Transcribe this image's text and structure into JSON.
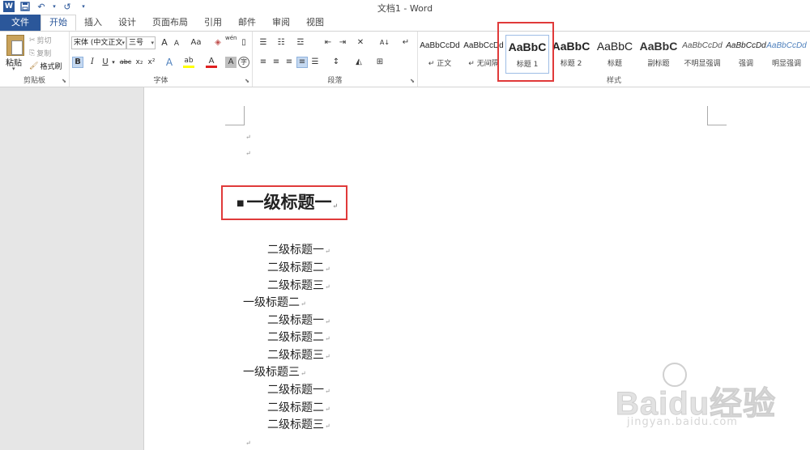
{
  "window": {
    "title": "文档1 - Word"
  },
  "qat": {
    "icons": [
      "word-icon",
      "save-icon",
      "undo-icon",
      "redo-icon",
      "customize-icon"
    ],
    "undo_glyph": "↶",
    "redo_glyph": "↺",
    "save_glyph": "💾",
    "more_glyph": "▾"
  },
  "tabs": [
    {
      "label": "文件"
    },
    {
      "label": "开始"
    },
    {
      "label": "插入"
    },
    {
      "label": "设计"
    },
    {
      "label": "页面布局"
    },
    {
      "label": "引用"
    },
    {
      "label": "邮件"
    },
    {
      "label": "审阅"
    },
    {
      "label": "视图"
    }
  ],
  "ribbon": {
    "clipboard": {
      "paste": "粘贴",
      "cut": "剪切",
      "copy": "复制",
      "format_painter": "格式刷",
      "group_label": "剪贴板"
    },
    "font": {
      "font_name": "宋体 (中文正文",
      "font_size": "三号",
      "group_label": "字体",
      "grow": "A",
      "shrink": "A",
      "case": "Aa",
      "bold": "B",
      "italic": "I",
      "underline": "U",
      "strike": "abc",
      "sub": "x₂",
      "sup": "x²",
      "effects": "A",
      "highlight": "ab",
      "color": "A",
      "shade": "A",
      "wen": "wén",
      "enclose": "字"
    },
    "paragraph": {
      "group_label": "段落",
      "sort": "A↓",
      "marks": "↵"
    },
    "styles": {
      "group_label": "样式",
      "items": [
        {
          "preview": "AaBbCcDd",
          "name": "↵ 正文"
        },
        {
          "preview": "AaBbCcDd",
          "name": "↵ 无间隔"
        },
        {
          "preview": "AaBbC",
          "name": "标题 1"
        },
        {
          "preview": "AaBbC",
          "name": "标题 2"
        },
        {
          "preview": "AaBbC",
          "name": "标题"
        },
        {
          "preview": "AaBbC",
          "name": "副标题"
        },
        {
          "preview": "AaBbCcDd",
          "name": "不明显强调"
        },
        {
          "preview": "AaBbCcDd",
          "name": "强调"
        },
        {
          "preview": "AaBbCcDd",
          "name": "明显强调"
        }
      ]
    }
  },
  "document": {
    "para_mark": "↵",
    "heading": "一级标题一",
    "lines": [
      {
        "text": "二级标题一",
        "level": 2
      },
      {
        "text": "二级标题二",
        "level": 2
      },
      {
        "text": "二级标题三",
        "level": 2
      },
      {
        "text": "一级标题二",
        "level": 1
      },
      {
        "text": "二级标题一",
        "level": 2
      },
      {
        "text": "二级标题二",
        "level": 2
      },
      {
        "text": "二级标题三",
        "level": 2
      },
      {
        "text": "一级标题三",
        "level": 1
      },
      {
        "text": "二级标题一",
        "level": 2
      },
      {
        "text": "二级标题二",
        "level": 2
      },
      {
        "text": "二级标题三",
        "level": 2
      }
    ]
  },
  "watermark": {
    "brand": "Baidu经验",
    "url": "jingyan.baidu.com"
  },
  "colors": {
    "accent": "#2b579a",
    "highlight_box": "#e03a3a"
  }
}
